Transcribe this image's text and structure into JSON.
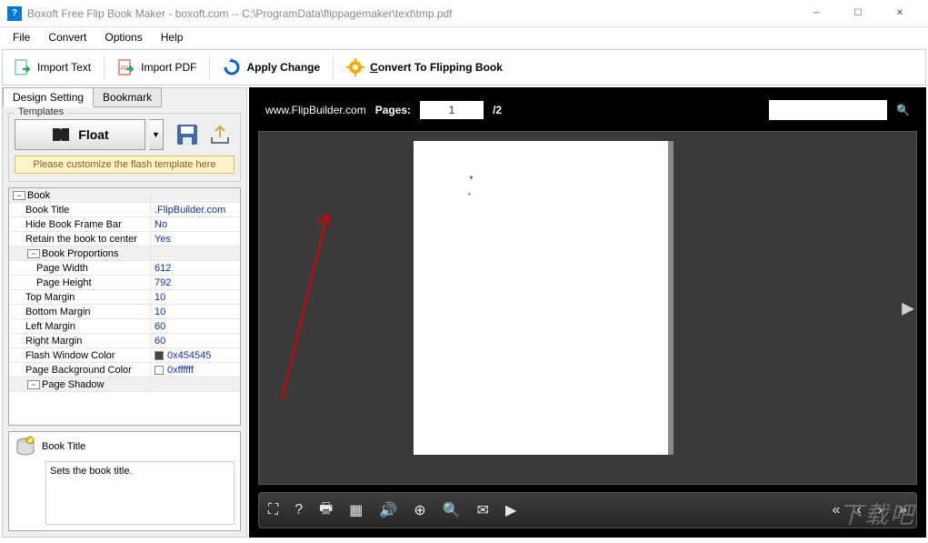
{
  "window": {
    "title": "Boxoft Free Flip Book Maker - boxoft.com -- C:\\ProgramData\\flippagemaker\\text\\tmp.pdf"
  },
  "menu": {
    "file": "File",
    "convert": "Convert",
    "options": "Options",
    "help": "Help"
  },
  "toolbar": {
    "import_text": "Import Text",
    "import_pdf": "Import PDF",
    "apply_change": "Apply Change",
    "convert_book": "Convert To Flipping Book",
    "convert_hotkey": "C"
  },
  "tabs": {
    "design": "Design Setting",
    "bookmark": "Bookmark"
  },
  "templates": {
    "legend": "Templates",
    "float": "Float",
    "customize_note": "Please customize the flash template here"
  },
  "props": [
    {
      "type": "header",
      "label": "Book"
    },
    {
      "type": "row",
      "indent": 1,
      "label": "Book Title",
      "value": ".FlipBuilder.com"
    },
    {
      "type": "row",
      "indent": 1,
      "label": "Hide Book Frame Bar",
      "value": "No"
    },
    {
      "type": "row",
      "indent": 1,
      "label": "Retain the book to center",
      "value": "Yes"
    },
    {
      "type": "header",
      "indent": 1,
      "label": "Book Proportions"
    },
    {
      "type": "row",
      "indent": 2,
      "label": "Page Width",
      "value": "612"
    },
    {
      "type": "row",
      "indent": 2,
      "label": "Page Height",
      "value": "792"
    },
    {
      "type": "row",
      "indent": 1,
      "label": "Top Margin",
      "value": "10"
    },
    {
      "type": "row",
      "indent": 1,
      "label": "Bottom Margin",
      "value": "10"
    },
    {
      "type": "row",
      "indent": 1,
      "label": "Left Margin",
      "value": "60"
    },
    {
      "type": "row",
      "indent": 1,
      "label": "Right Margin",
      "value": "60"
    },
    {
      "type": "row",
      "indent": 1,
      "label": "Flash Window Color",
      "value": "0x454545",
      "swatch": "#454545"
    },
    {
      "type": "row",
      "indent": 1,
      "label": "Page Background Color",
      "value": "0xffffff",
      "swatch": "#ffffff"
    },
    {
      "type": "header",
      "indent": 1,
      "label": "Page Shadow"
    }
  ],
  "help": {
    "title": "Book Title",
    "body": "Sets the book title."
  },
  "preview": {
    "brand": "www.FlipBuilder.com",
    "pages_label": "Pages:",
    "current_page": "1",
    "page_total": "/2"
  },
  "watermark": "下载吧"
}
